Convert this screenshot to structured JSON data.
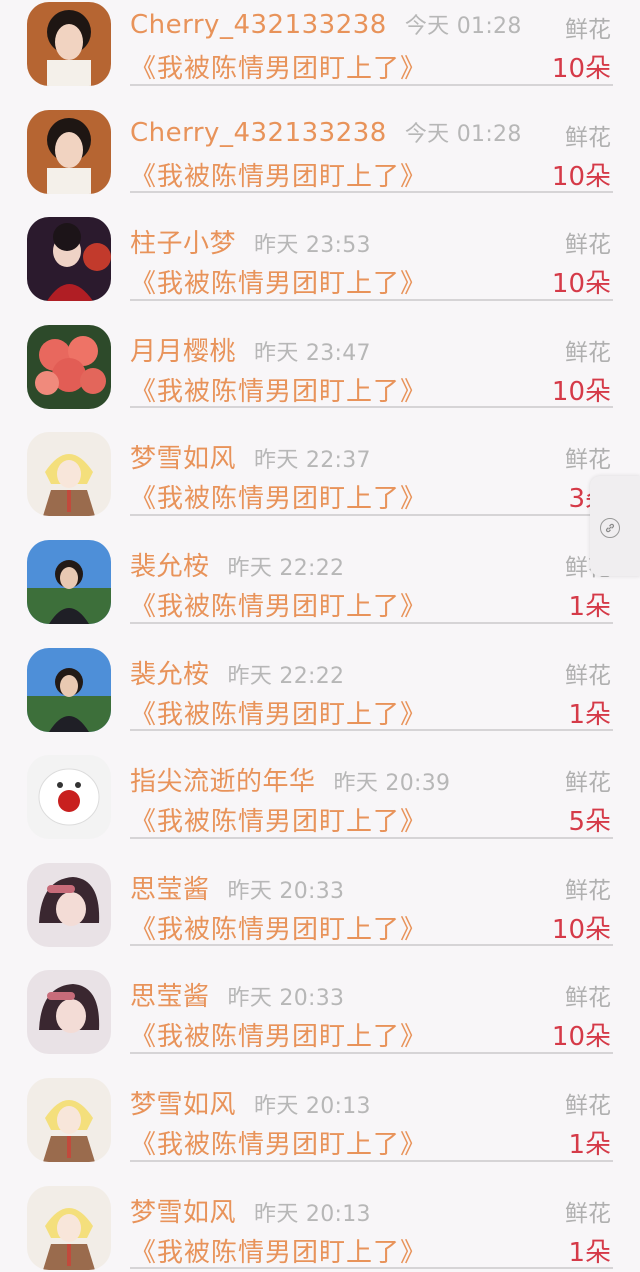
{
  "gifts": [
    {
      "name": "Cherry_432133238",
      "time": "今天 01:28",
      "label": "鲜花",
      "title": "《我被陈情男团盯上了》",
      "count": "10朵",
      "avatar": "portrait-man-dark"
    },
    {
      "name": "Cherry_432133238",
      "time": "今天 01:28",
      "label": "鲜花",
      "title": "《我被陈情男团盯上了》",
      "count": "10朵",
      "avatar": "portrait-man-dark"
    },
    {
      "name": "柱子小梦",
      "time": "昨天 23:53",
      "label": "鲜花",
      "title": "《我被陈情男团盯上了》",
      "count": "10朵",
      "avatar": "portrait-red-costume"
    },
    {
      "name": "月月樱桃",
      "time": "昨天 23:47",
      "label": "鲜花",
      "title": "《我被陈情男团盯上了》",
      "count": "10朵",
      "avatar": "red-flowers"
    },
    {
      "name": "梦雪如风",
      "time": "昨天 22:37",
      "label": "鲜花",
      "title": "《我被陈情男团盯上了》",
      "count": "3朵",
      "avatar": "anime-blonde"
    },
    {
      "name": "裴允桉",
      "time": "昨天 22:22",
      "label": "鲜花",
      "title": "《我被陈情男团盯上了》",
      "count": "1朵",
      "avatar": "photo-girl-blue-sky"
    },
    {
      "name": "裴允桉",
      "time": "昨天 22:22",
      "label": "鲜花",
      "title": "《我被陈情男团盯上了》",
      "count": "1朵",
      "avatar": "photo-girl-blue-sky"
    },
    {
      "name": "指尖流逝的年华",
      "time": "昨天 20:39",
      "label": "鲜花",
      "title": "《我被陈情男团盯上了》",
      "count": "5朵",
      "avatar": "white-dog-red-flower"
    },
    {
      "name": "思莹酱",
      "time": "昨天 20:33",
      "label": "鲜花",
      "title": "《我被陈情男团盯上了》",
      "count": "10朵",
      "avatar": "anime-dark-hair"
    },
    {
      "name": "思莹酱",
      "time": "昨天 20:33",
      "label": "鲜花",
      "title": "《我被陈情男团盯上了》",
      "count": "10朵",
      "avatar": "anime-dark-hair"
    },
    {
      "name": "梦雪如风",
      "time": "昨天 20:13",
      "label": "鲜花",
      "title": "《我被陈情男团盯上了》",
      "count": "1朵",
      "avatar": "anime-blonde"
    },
    {
      "name": "梦雪如风",
      "time": "昨天 20:13",
      "label": "鲜花",
      "title": "《我被陈情男团盯上了》",
      "count": "1朵",
      "avatar": "anime-blonde"
    }
  ],
  "floating": {
    "icon": "link-icon"
  },
  "colors": {
    "name": "#e8935a",
    "count": "#d53a48",
    "meta": "#b7b7b7",
    "divider": "#d6d4d6",
    "background": "#f8f6f8"
  }
}
